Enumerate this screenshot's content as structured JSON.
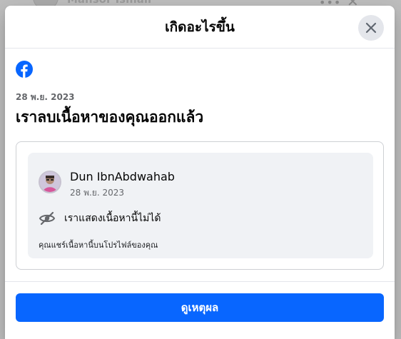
{
  "background": {
    "author_name": "Mansor Ismail"
  },
  "dialog": {
    "title": "เกิดอะไรขึ้น",
    "close_icon": "close-icon",
    "logo_icon": "facebook-logo-icon",
    "date": "28 พ.ย. 2023",
    "headline": "เราลบเนื้อหาของคุณออกแล้ว"
  },
  "post": {
    "author": "Dun IbnAbdwahab",
    "date": "28 พ.ย. 2023",
    "hidden_icon": "eye-slash-icon",
    "hidden_label": "เราแสดงเนื้อหานี้ไม่ได้",
    "note": "คุณแชร์เนื้อหานี้บนโปรไฟล์ของคุณ"
  },
  "actions": {
    "primary_label": "ดูเหตุผล"
  },
  "colors": {
    "accent": "#0866ff",
    "text_secondary": "#65676b",
    "card_bg": "#f0f2f5"
  }
}
